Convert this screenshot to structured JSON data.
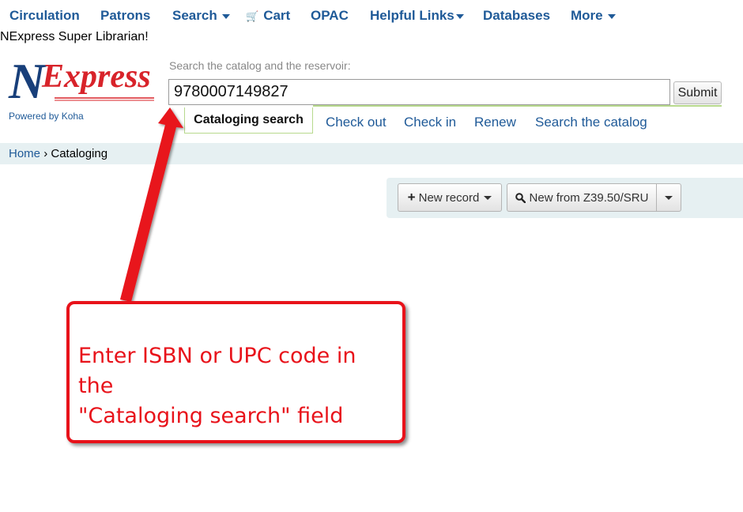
{
  "nav": {
    "items": [
      {
        "label": "Circulation",
        "dropdown": false
      },
      {
        "label": "Patrons",
        "dropdown": false
      },
      {
        "label": "Search",
        "dropdown": true
      },
      {
        "label": "Cart",
        "dropdown": false,
        "icon": "cart-icon"
      },
      {
        "label": "OPAC",
        "dropdown": false
      },
      {
        "label": "Helpful Links",
        "dropdown": true
      },
      {
        "label": "Databases",
        "dropdown": false
      },
      {
        "label": "More",
        "dropdown": true
      }
    ]
  },
  "welcome": "NExpress Super Librarian!",
  "logo": {
    "text": "NExpress",
    "powered_by": "Powered by Koha"
  },
  "search": {
    "label": "Search the catalog and the reservoir:",
    "value": "9780007149827",
    "submit_label": "Submit",
    "tabs": [
      {
        "label": "Cataloging search",
        "active": true
      },
      {
        "label": "Check out",
        "active": false
      },
      {
        "label": "Check in",
        "active": false
      },
      {
        "label": "Renew",
        "active": false
      },
      {
        "label": "Search the catalog",
        "active": false
      }
    ]
  },
  "breadcrumb": {
    "home": "Home",
    "separator": "›",
    "current": "Cataloging"
  },
  "toolbar": {
    "new_record_label": "New record",
    "new_z3950_label": "New from Z39.50/SRU"
  },
  "annotation": {
    "text_line1": "Enter ISBN or UPC code in the",
    "text_line2": "\"Cataloging search\" field"
  },
  "colors": {
    "link": "#1f5a98",
    "annotation": "#e8121a",
    "tab_border": "#b7d98d",
    "bar_bg": "#e6f0f2"
  }
}
